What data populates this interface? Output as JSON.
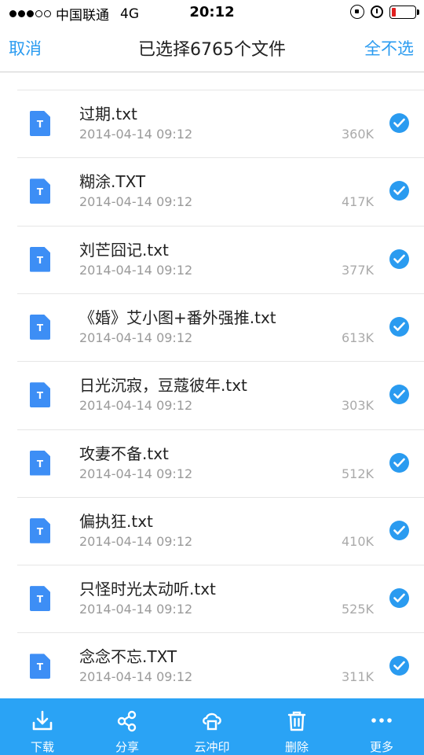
{
  "status_bar": {
    "carrier": "中国联通",
    "network": "4G",
    "time": "20:12"
  },
  "nav": {
    "cancel_label": "取消",
    "title": "已选择6765个文件",
    "select_none_label": "全不选"
  },
  "files": [
    {
      "name": "过期.txt",
      "date": "2014-04-14 09:12",
      "size": "360K",
      "icon_letter": "T",
      "checked": true
    },
    {
      "name": "糊涂.TXT",
      "date": "2014-04-14 09:12",
      "size": "417K",
      "icon_letter": "T",
      "checked": true
    },
    {
      "name": "刘芒囧记.txt",
      "date": "2014-04-14 09:12",
      "size": "377K",
      "icon_letter": "T",
      "checked": true
    },
    {
      "name": "《婚》艾小图+番外强推.txt",
      "date": "2014-04-14 09:12",
      "size": "613K",
      "icon_letter": "T",
      "checked": true
    },
    {
      "name": "日光沉寂，豆蔻彼年.txt",
      "date": "2014-04-14 09:12",
      "size": "303K",
      "icon_letter": "T",
      "checked": true
    },
    {
      "name": "攻妻不备.txt",
      "date": "2014-04-14 09:12",
      "size": "512K",
      "icon_letter": "T",
      "checked": true
    },
    {
      "name": "偏执狂.txt",
      "date": "2014-04-14 09:12",
      "size": "410K",
      "icon_letter": "T",
      "checked": true
    },
    {
      "name": "只怪时光太动听.txt",
      "date": "2014-04-14 09:12",
      "size": "525K",
      "icon_letter": "T",
      "checked": true
    },
    {
      "name": "念念不忘.TXT",
      "date": "2014-04-14 09:12",
      "size": "311K",
      "icon_letter": "T",
      "checked": true
    }
  ],
  "toolbar": {
    "download_label": "下载",
    "share_label": "分享",
    "print_label": "云冲印",
    "delete_label": "删除",
    "more_label": "更多"
  },
  "colors": {
    "accent": "#2a9bf0",
    "toolbar_bg": "#2aa3f5",
    "file_icon": "#3d8ef5",
    "battery_low": "#e02020"
  }
}
